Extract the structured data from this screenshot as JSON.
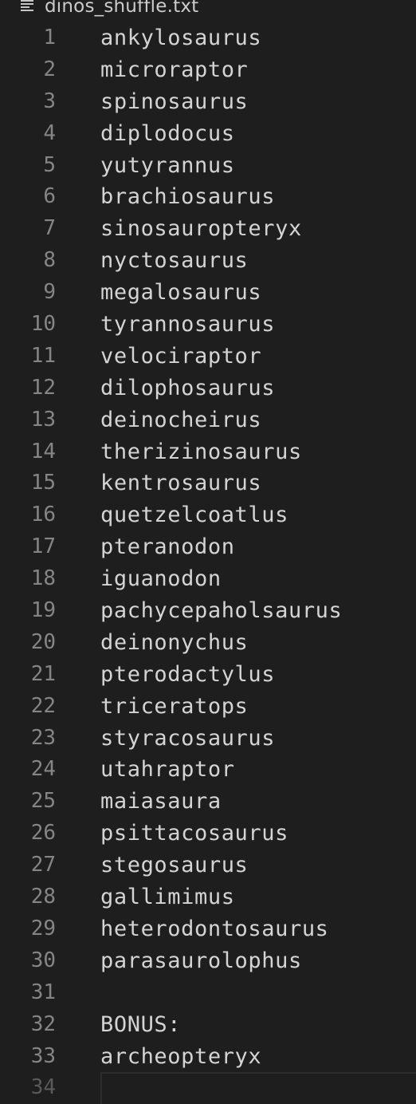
{
  "file": {
    "name": "dinos_shuffle.txt",
    "icon": "text-file-icon"
  },
  "lines": [
    {
      "num": "1",
      "text": "ankylosaurus"
    },
    {
      "num": "2",
      "text": "microraptor"
    },
    {
      "num": "3",
      "text": "spinosaurus"
    },
    {
      "num": "4",
      "text": "diplodocus"
    },
    {
      "num": "5",
      "text": "yutyrannus"
    },
    {
      "num": "6",
      "text": "brachiosaurus"
    },
    {
      "num": "7",
      "text": "sinosauropteryx"
    },
    {
      "num": "8",
      "text": "nyctosaurus"
    },
    {
      "num": "9",
      "text": "megalosaurus"
    },
    {
      "num": "10",
      "text": "tyrannosaurus"
    },
    {
      "num": "11",
      "text": "velociraptor"
    },
    {
      "num": "12",
      "text": "dilophosaurus"
    },
    {
      "num": "13",
      "text": "deinocheirus"
    },
    {
      "num": "14",
      "text": "therizinosaurus"
    },
    {
      "num": "15",
      "text": "kentrosaurus"
    },
    {
      "num": "16",
      "text": "quetzelcoatlus"
    },
    {
      "num": "17",
      "text": "pteranodon"
    },
    {
      "num": "18",
      "text": "iguanodon"
    },
    {
      "num": "19",
      "text": "pachycepaholsaurus"
    },
    {
      "num": "20",
      "text": "deinonychus"
    },
    {
      "num": "21",
      "text": "pterodactylus"
    },
    {
      "num": "22",
      "text": "triceratops"
    },
    {
      "num": "23",
      "text": "styracosaurus"
    },
    {
      "num": "24",
      "text": "utahraptor"
    },
    {
      "num": "25",
      "text": "maiasaura"
    },
    {
      "num": "26",
      "text": "psittacosaurus"
    },
    {
      "num": "27",
      "text": "stegosaurus"
    },
    {
      "num": "28",
      "text": "gallimimus"
    },
    {
      "num": "29",
      "text": "heterodontosaurus"
    },
    {
      "num": "30",
      "text": "parasaurolophus"
    },
    {
      "num": "31",
      "text": ""
    },
    {
      "num": "32",
      "text": "BONUS:"
    },
    {
      "num": "33",
      "text": "archeopteryx"
    },
    {
      "num": "34",
      "text": "",
      "current": true
    }
  ],
  "colors": {
    "background": "#1e1e1e",
    "text": "#d4d4d4",
    "line_number": "#858585"
  }
}
